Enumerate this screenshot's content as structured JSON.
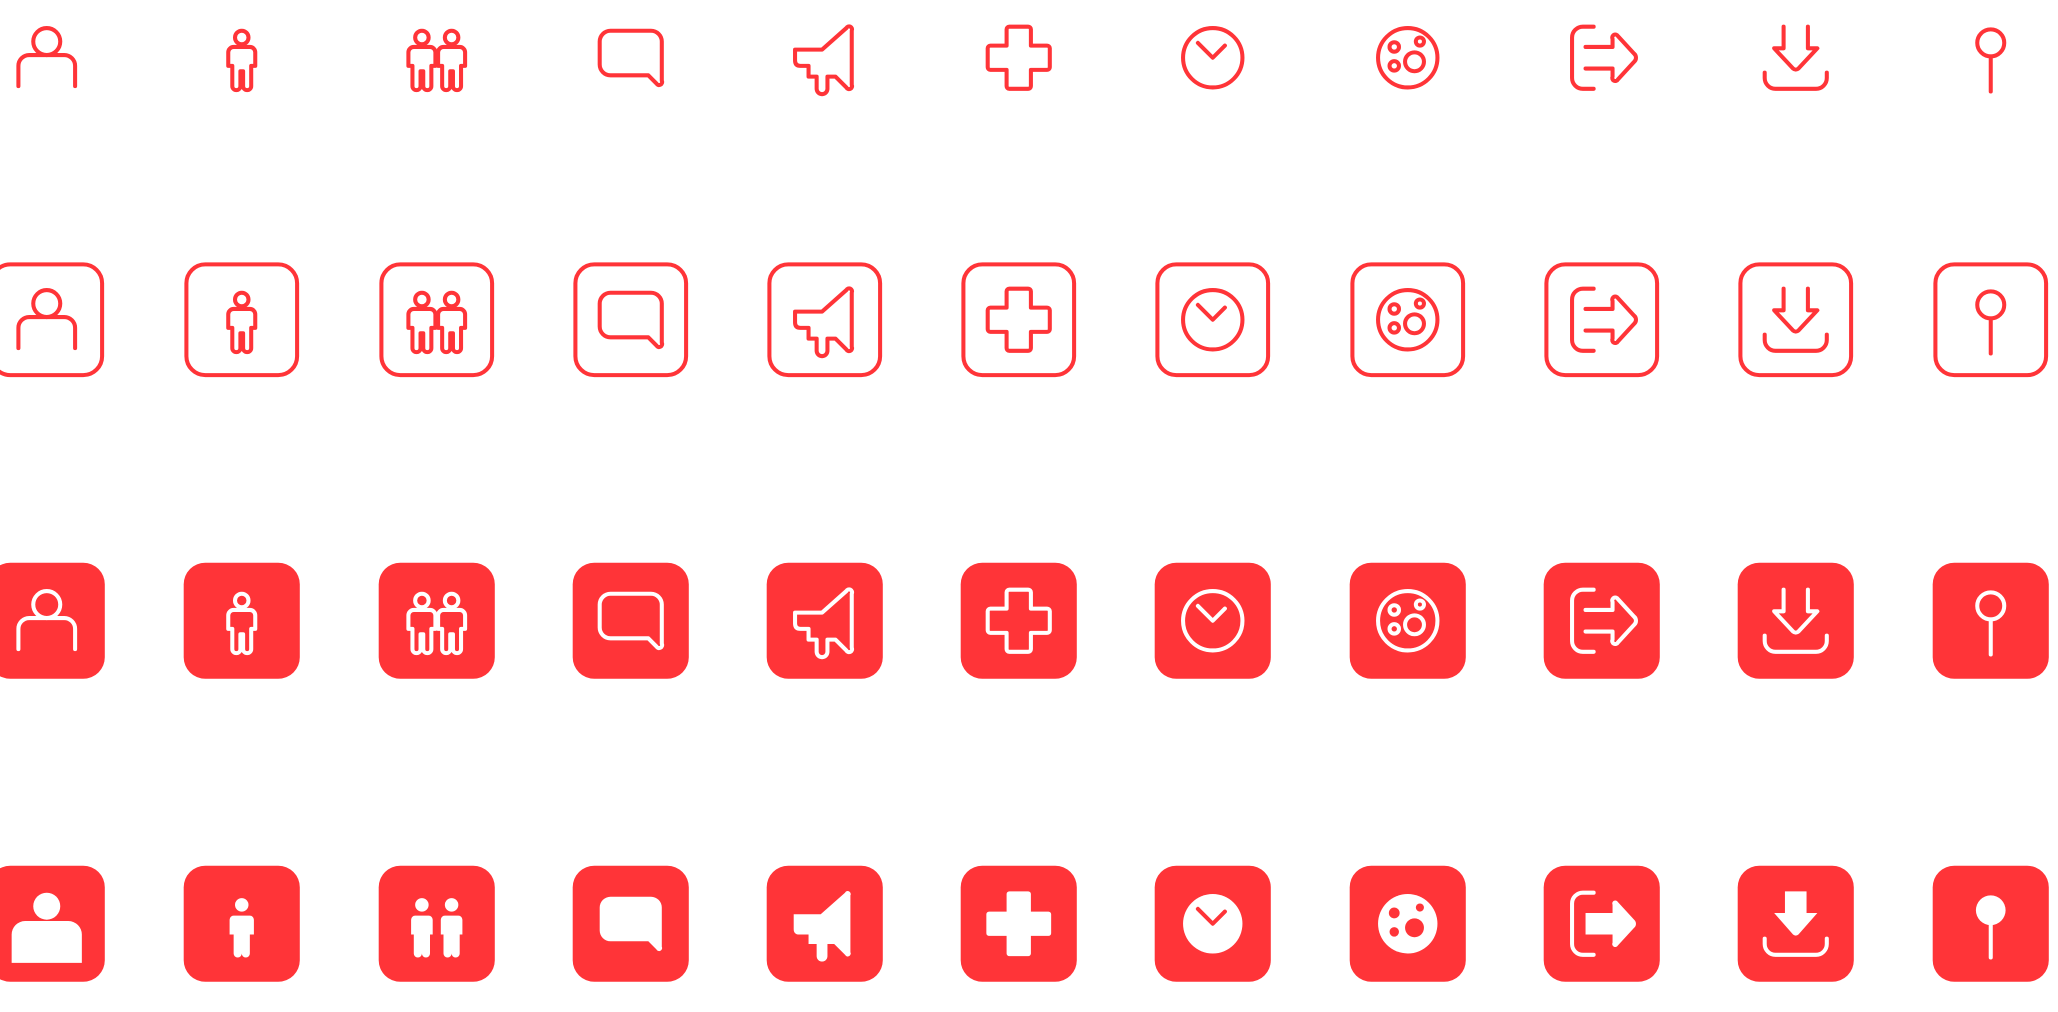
{
  "colors": {
    "accent": "#ff3438",
    "background": "#ffffff"
  },
  "icons": [
    "user-icon",
    "person-icon",
    "people-icon",
    "speech-bubble-icon",
    "megaphone-icon",
    "medical-cross-icon",
    "clock-icon",
    "cells-icon",
    "logout-icon",
    "download-icon",
    "map-pin-icon"
  ],
  "styles": [
    "outline",
    "outline-framed",
    "filled-outline",
    "filled-solid"
  ]
}
